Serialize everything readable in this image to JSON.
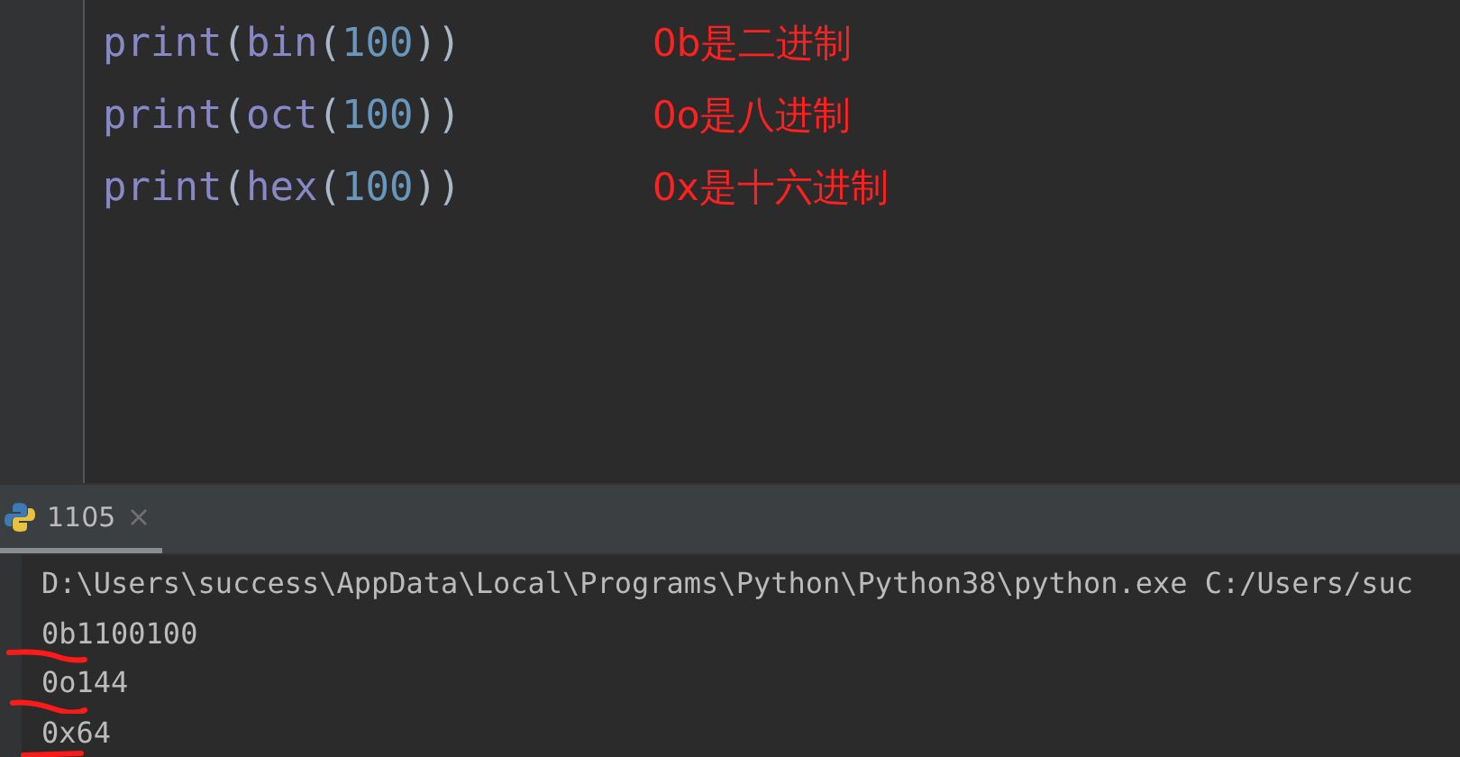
{
  "editor": {
    "lines": [
      {
        "code": "print(bin(100))",
        "annotation": "0b是二进制"
      },
      {
        "code": "print(oct(100))",
        "annotation": "0o是八进制"
      },
      {
        "code": "print(hex(100))",
        "annotation": "0x是十六进制"
      }
    ]
  },
  "run_panel": {
    "tabs": [
      {
        "label": "1105",
        "selected": true
      }
    ],
    "console": [
      {
        "text": "D:\\Users\\success\\AppData\\Local\\Programs\\Python\\Python38\\python.exe C:/Users/suc",
        "marked": false
      },
      {
        "text": "0b1100100",
        "marked": true
      },
      {
        "text": "0o144",
        "marked": true
      },
      {
        "text": "0x64",
        "marked": true
      }
    ]
  }
}
